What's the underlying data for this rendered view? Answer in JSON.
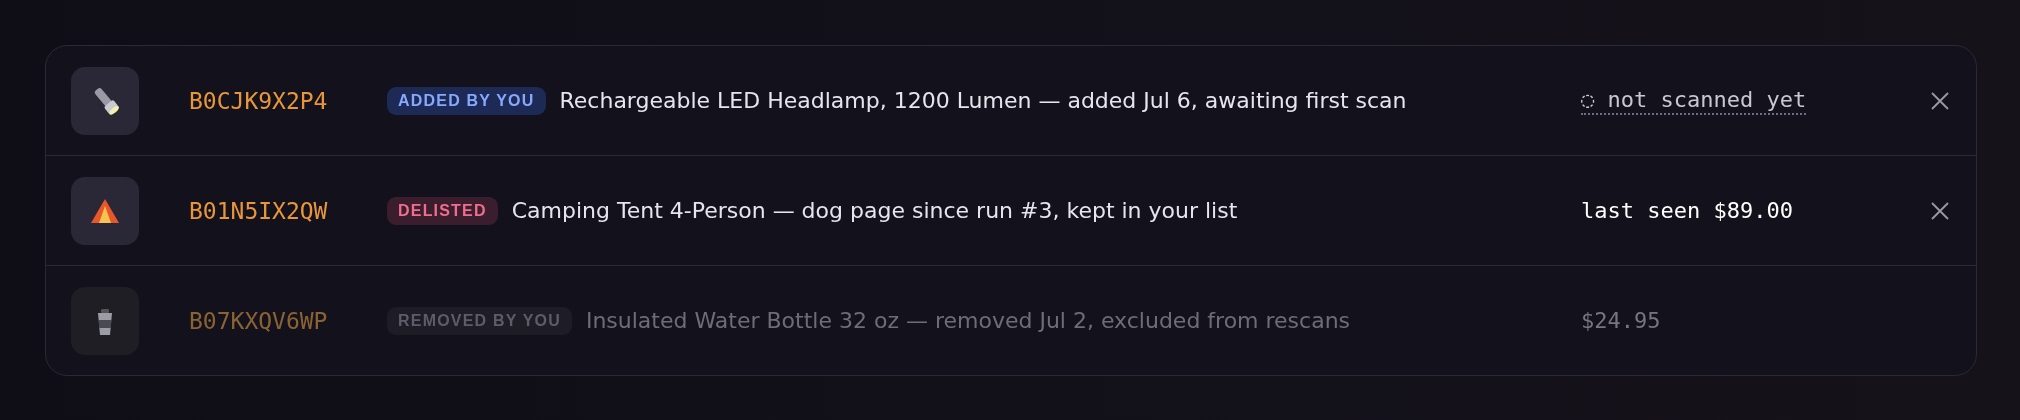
{
  "items": [
    {
      "thumbnail": {
        "kind": "flashlight"
      },
      "asin": "B0CJK9X2P4",
      "kind": "added",
      "badge": "ADDED BY YOU",
      "description": "Rechargeable LED Headlamp, 1200 Lumen — added Jul 6, awaiting first scan",
      "price": "◌ not scanned yet",
      "pending": true,
      "dismissible": true
    },
    {
      "thumbnail": {
        "kind": "tent"
      },
      "asin": "B01N5IX2QW",
      "kind": "delisted",
      "badge": "DELISTED",
      "description": "Camping Tent 4-Person — dog page since run #3, kept in your list",
      "price": "last seen $89.00",
      "pending": false,
      "dismissible": true
    },
    {
      "thumbnail": {
        "kind": "cup"
      },
      "asin": "B07KXQV6WP",
      "kind": "removed",
      "badge": "REMOVED BY YOU",
      "description": "Insulated Water Bottle 32 oz — removed Jul 2, excluded from rescans",
      "price": "$24.95",
      "pending": false,
      "dismissible": false
    }
  ]
}
